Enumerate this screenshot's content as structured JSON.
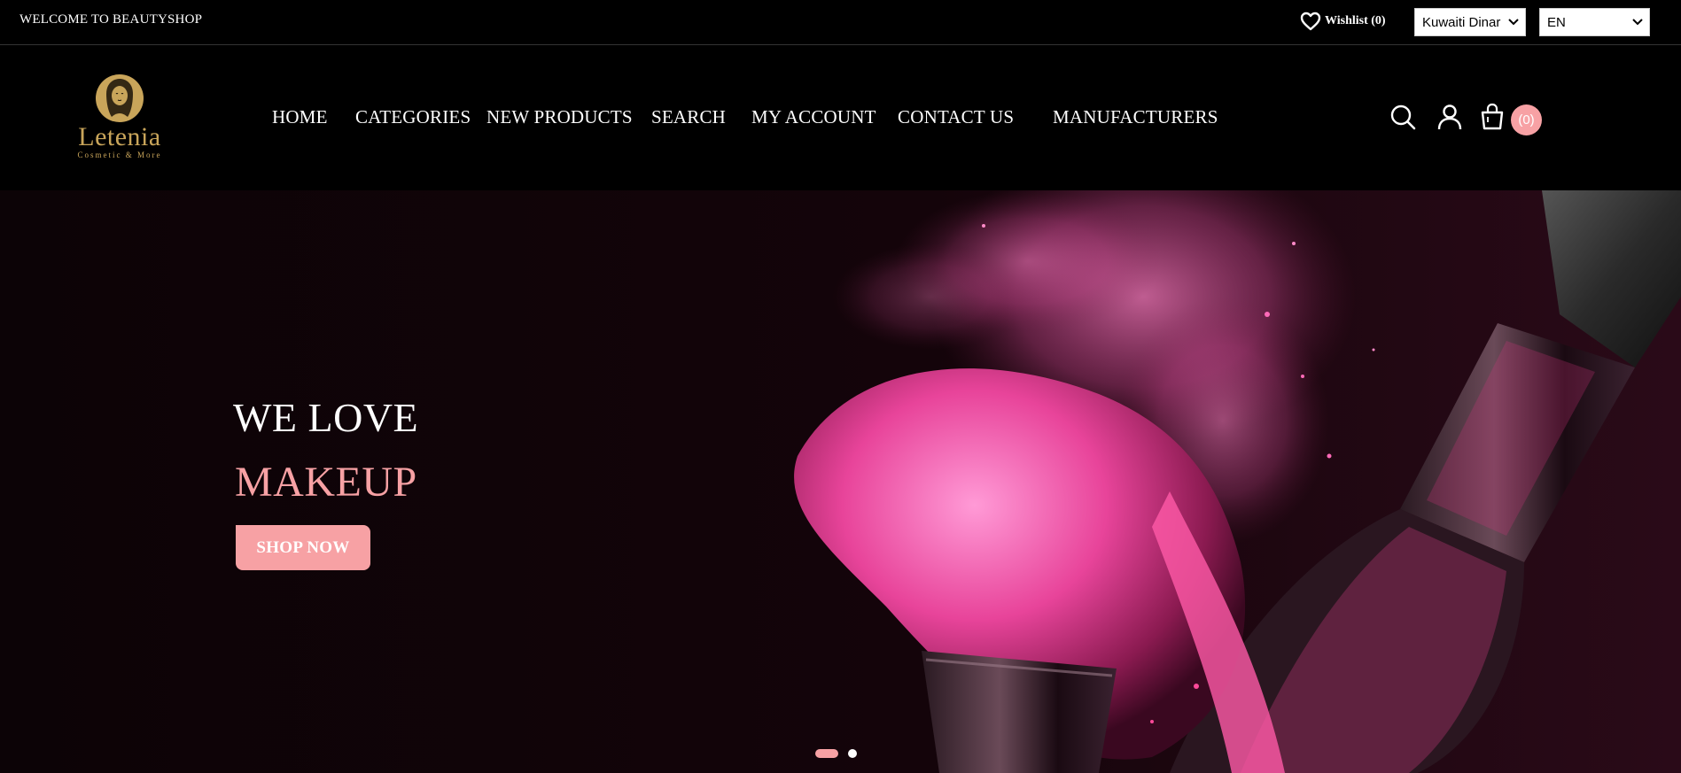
{
  "topbar": {
    "welcome": "WELCOME TO BEAUTYSHOP",
    "wishlist": "Wishlist (0)",
    "currency": "Kuwaiti Dinar",
    "language": "EN"
  },
  "logo": {
    "name": "Letenia",
    "tagline": "Cosmetic & More"
  },
  "nav": [
    "HOME",
    "CATEGORIES",
    "NEW PRODUCTS",
    "SEARCH",
    "MY ACCOUNT",
    "CONTACT US",
    "MANUFACTURERS"
  ],
  "header": {
    "cart_count": "(0)"
  },
  "hero": {
    "line1": "WE LOVE",
    "line2": "MAKEUP",
    "button": "SHOP NOW"
  },
  "colors": {
    "accent": "#f7a1a4",
    "gold": "#c9a55a",
    "background": "#000000"
  },
  "icons": [
    "heart-icon",
    "chevron-down-icon",
    "search-icon",
    "user-icon",
    "shopping-bag-icon",
    "logo-emblem-icon"
  ]
}
